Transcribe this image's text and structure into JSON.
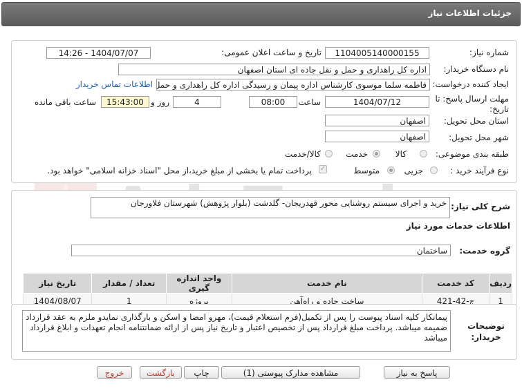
{
  "header": {
    "title": "جزئیات اطلاعات نیاز"
  },
  "fields": {
    "need_number_label": "شماره نیاز:",
    "need_number": "1104005140000155",
    "announce_label": "تاریخ و ساعت اعلان عمومی:",
    "announce_value": "1404/07/07 - 14:26",
    "buyer_label": "نام دستگاه خریدار:",
    "buyer": "اداره کل راهداری و حمل و نقل جاده ای استان اصفهان",
    "creator_label": "ایجاد کننده درخواست:",
    "creator": "فاطمه سلما موسوی کارشناس اداره پیمان و رسیدگی اداره کل راهداری و حمل",
    "contact_link": "اطلاعات تماس خریدار",
    "deadline_label": "مهلت ارسال پاسخ: تا تاریخ:",
    "deadline_date": "1404/07/12",
    "time_label": "ساعت",
    "deadline_time": "08:00",
    "days_value": "4",
    "days_label": "روز و",
    "remaining_time": "15:43:00",
    "remaining_label": "ساعت باقی مانده",
    "province_label": "استان محل تحویل:",
    "province": "اصفهان",
    "city_label": "شهر محل تحویل:",
    "city": "اصفهان",
    "category_label": "طبقه بندی موضوعی:",
    "category_options": [
      "کالا",
      "خدمت",
      "کالا/خدمت"
    ],
    "process_label": "نوع فرآیند خرید :",
    "process_options": [
      "جزیی",
      "متوسط"
    ],
    "payment_note": "پرداخت تمام یا بخشی از مبلغ خرید،از محل \"اسناد خزانه اسلامی\" خواهد بود."
  },
  "description": {
    "label": "شرح کلی نیاز:",
    "text": "خرید و اجرای سیستم روشنایی محور قهدریجان- گلدشت (بلوار پژوهش) شهرستان فلاورجان"
  },
  "services": {
    "section_title": "اطلاعات خدمات مورد نیاز",
    "group_label": "گروه خدمت:",
    "group_value": "ساختمان"
  },
  "table": {
    "headers": [
      "ردیف",
      "کد خدمت",
      "نام خدمت",
      "واحد اندازه گیری",
      "تعداد / مقدار",
      "تاریخ نیاز"
    ],
    "rows": [
      [
        "1",
        "ج-42-421",
        "ساخت جاده و راه‌آهن",
        "پروژه",
        "1",
        "1404/08/07"
      ]
    ]
  },
  "notes": {
    "label": "توضیحات خریدار:",
    "text": "پیمانکار کلیه اسناد پیوست را پس از تکمیل(فرم استعلام قیمت)، مهرو امضا و اسکن و بارگذاری نمایدو ملزم به عقد قرارداد ضمیمه میباشد. پرداخت مبلغ قرارداد پس از تخصیص اعتبار و تاریخ نیاز پس از ارائه ضمانتنامه انجام تعهدات و ابلاغ قرارداد میباشد"
  },
  "buttons": {
    "respond": "پاسخ به نیاز",
    "attachments": "مشاهده مدارک پیوستی (1)",
    "print": "چاپ",
    "back": "بازگشت",
    "exit": "خروج"
  },
  "watermark": {
    "text": "AriaTender.net"
  },
  "colors": {
    "link": "#1a5fb4",
    "exit_text": "#c0392b",
    "yellow_box": "#fdf8cf",
    "header_bg": "#6b6b6b"
  }
}
